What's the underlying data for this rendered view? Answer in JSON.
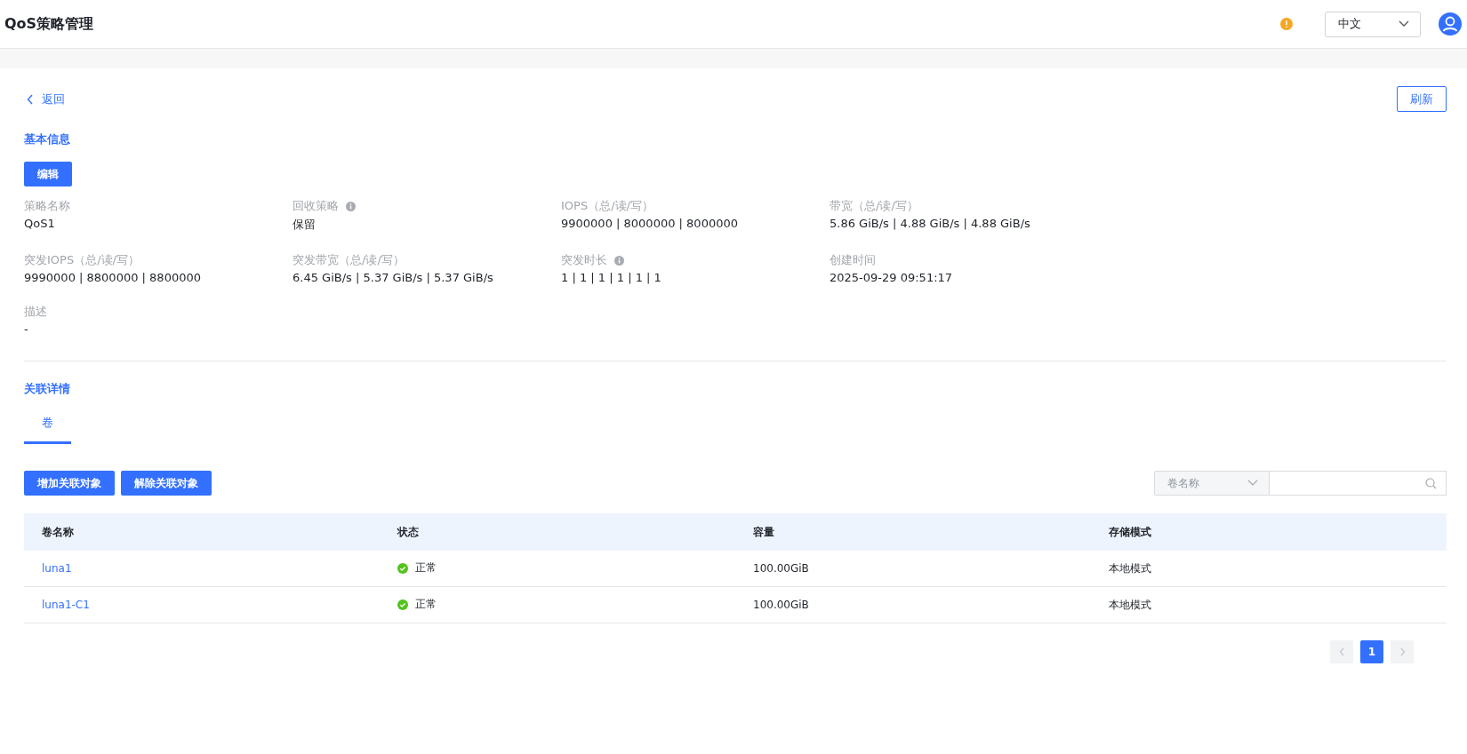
{
  "header": {
    "title": "QoS策略管理",
    "language": "中文"
  },
  "back": "返回",
  "refresh": "刷新",
  "basic": {
    "title": "基本信息",
    "edit": "编辑",
    "fields": [
      {
        "label": "策略名称",
        "info": false,
        "value": "QoS1"
      },
      {
        "label": "回收策略",
        "info": true,
        "value": "保留"
      },
      {
        "label": "IOPS（总/读/写）",
        "info": false,
        "value": "9900000 | 8000000 | 8000000"
      },
      {
        "label": "带宽（总/读/写）",
        "info": false,
        "value": "5.86 GiB/s | 4.88 GiB/s | 4.88 GiB/s"
      },
      {
        "label": "突发IOPS（总/读/写）",
        "info": false,
        "value": "9990000 | 8800000 | 8800000"
      },
      {
        "label": "突发带宽（总/读/写）",
        "info": false,
        "value": "6.45 GiB/s | 5.37 GiB/s | 5.37 GiB/s"
      },
      {
        "label": "突发时长",
        "info": true,
        "value": "1 | 1 | 1 | 1 | 1 | 1"
      },
      {
        "label": "创建时间",
        "info": false,
        "value": "2025-09-29 09:51:17"
      },
      {
        "label": "描述",
        "info": false,
        "value": "-"
      }
    ]
  },
  "relation": {
    "title": "关联详情",
    "tabs": [
      {
        "label": "卷",
        "selected": true
      }
    ],
    "actions": [
      "增加关联对象",
      "解除关联对象"
    ],
    "filter": {
      "field": "卷名称"
    },
    "table": {
      "columns": [
        "卷名称",
        "状态",
        "容量",
        "存储模式"
      ],
      "rows": [
        {
          "name": "luna1",
          "status": "正常",
          "capacity": "100.00GiB",
          "mode": "本地模式"
        },
        {
          "name": "luna1-C1",
          "status": "正常",
          "capacity": "100.00GiB",
          "mode": "本地模式"
        }
      ]
    },
    "pagination": {
      "prev_disabled": true,
      "next_disabled": true,
      "pages": [
        {
          "label": "1",
          "selected": true
        }
      ]
    }
  }
}
